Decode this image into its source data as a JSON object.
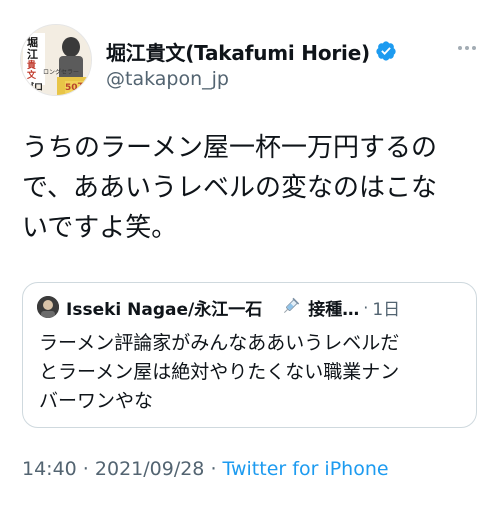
{
  "author": {
    "display_name": "堀江貴文(Takafumi Horie)",
    "handle": "@takapon_jp",
    "avatar": {
      "title_chars": [
        "堀江",
        "貴文",
        "ゼロ"
      ],
      "tagline": "ロングセラー",
      "sales_badge": "50万部"
    }
  },
  "tweet": {
    "lines": [
      "うちのラーメン屋一杯一万円するの",
      "で、ああいうレベルの変なのはこな",
      "いですよ笑。"
    ]
  },
  "quoted_tweet": {
    "author_name": "Isseki Nagae/永江一石",
    "author_name2": "接種…",
    "separator": "·",
    "time": "1日",
    "lines": [
      "ラーメン評論家がみんなああいうレベルだ",
      "とラーメン屋は絶対やりたくない職業ナン",
      "バーワンやな"
    ]
  },
  "footer": {
    "time": "14:40",
    "sep1": " · ",
    "date": "2021/09/28",
    "sep2": " · ",
    "source": "Twitter for iPhone"
  },
  "colors": {
    "verified": "#1d9bf0",
    "link": "#1d9bf0",
    "secondary_text": "#536471",
    "border": "#cfd9de"
  },
  "icons": [
    "verified-badge-icon",
    "more-icon",
    "syringe-icon"
  ]
}
